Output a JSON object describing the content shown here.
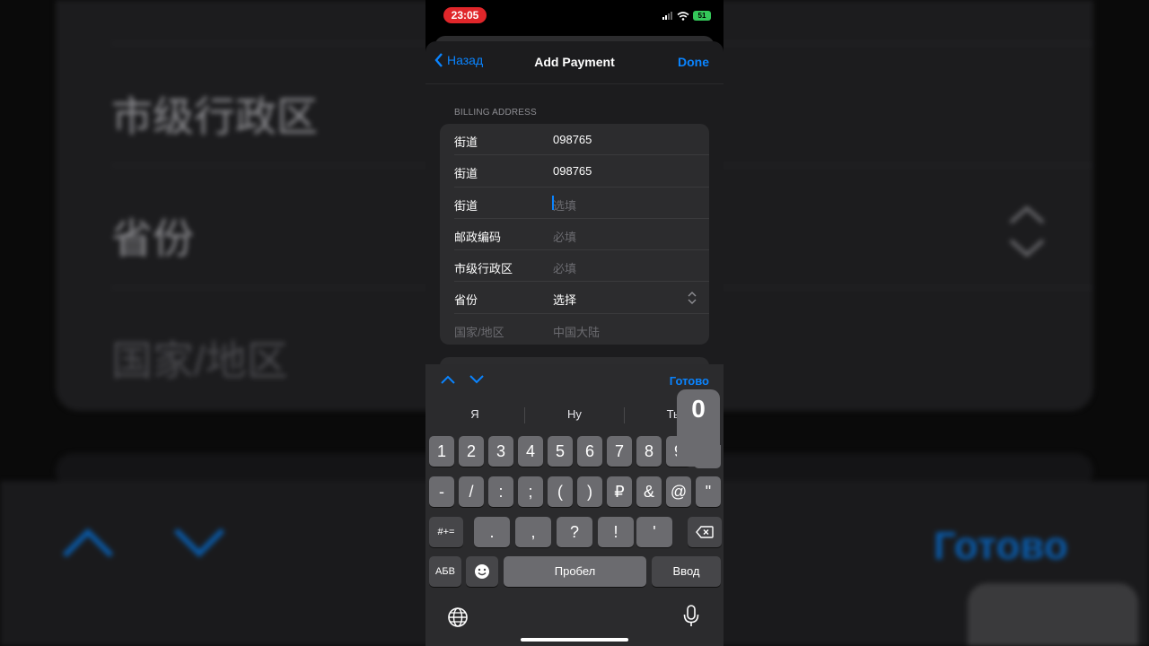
{
  "status_bar": {
    "time": "23:05",
    "battery": "51"
  },
  "nav": {
    "back_label": "Назад",
    "title": "Add Payment",
    "done_label": "Done"
  },
  "billing": {
    "header": "BILLING ADDRESS",
    "rows": [
      {
        "label": "街道",
        "value": "098765",
        "placeholder": false
      },
      {
        "label": "街道",
        "value": "098765",
        "placeholder": false
      },
      {
        "label": "街道",
        "value": "选填",
        "placeholder": true
      },
      {
        "label": "邮政编码",
        "value": "必填",
        "placeholder": true
      },
      {
        "label": "市级行政区",
        "value": "必填",
        "placeholder": true
      },
      {
        "label": "省份",
        "value": "选择",
        "placeholder": false
      },
      {
        "label": "国家/地区",
        "value": "中国大陆",
        "placeholder": true
      }
    ]
  },
  "keyboard": {
    "done_label": "Готово",
    "suggestions": [
      "Я",
      "Ну",
      "Ты"
    ],
    "row1": [
      "1",
      "2",
      "3",
      "4",
      "5",
      "6",
      "7",
      "8",
      "9",
      "0"
    ],
    "row2": [
      "-",
      "/",
      ":",
      ";",
      "(",
      ")",
      "₽",
      "&",
      "@",
      "\""
    ],
    "row3_left": "#+=",
    "row3": [
      ".",
      ",",
      "?",
      "!",
      "'"
    ],
    "row4_left": "АБВ",
    "space_label": "Пробел",
    "return_label": "Ввод",
    "pressed_key": "0"
  },
  "background": {
    "rows": [
      "市级行政区",
      "省份",
      "国家/地区"
    ],
    "done_label": "Готово"
  },
  "colors": {
    "accent": "#0a84ff",
    "time_pill": "#e0262a",
    "battery": "#34c759"
  }
}
